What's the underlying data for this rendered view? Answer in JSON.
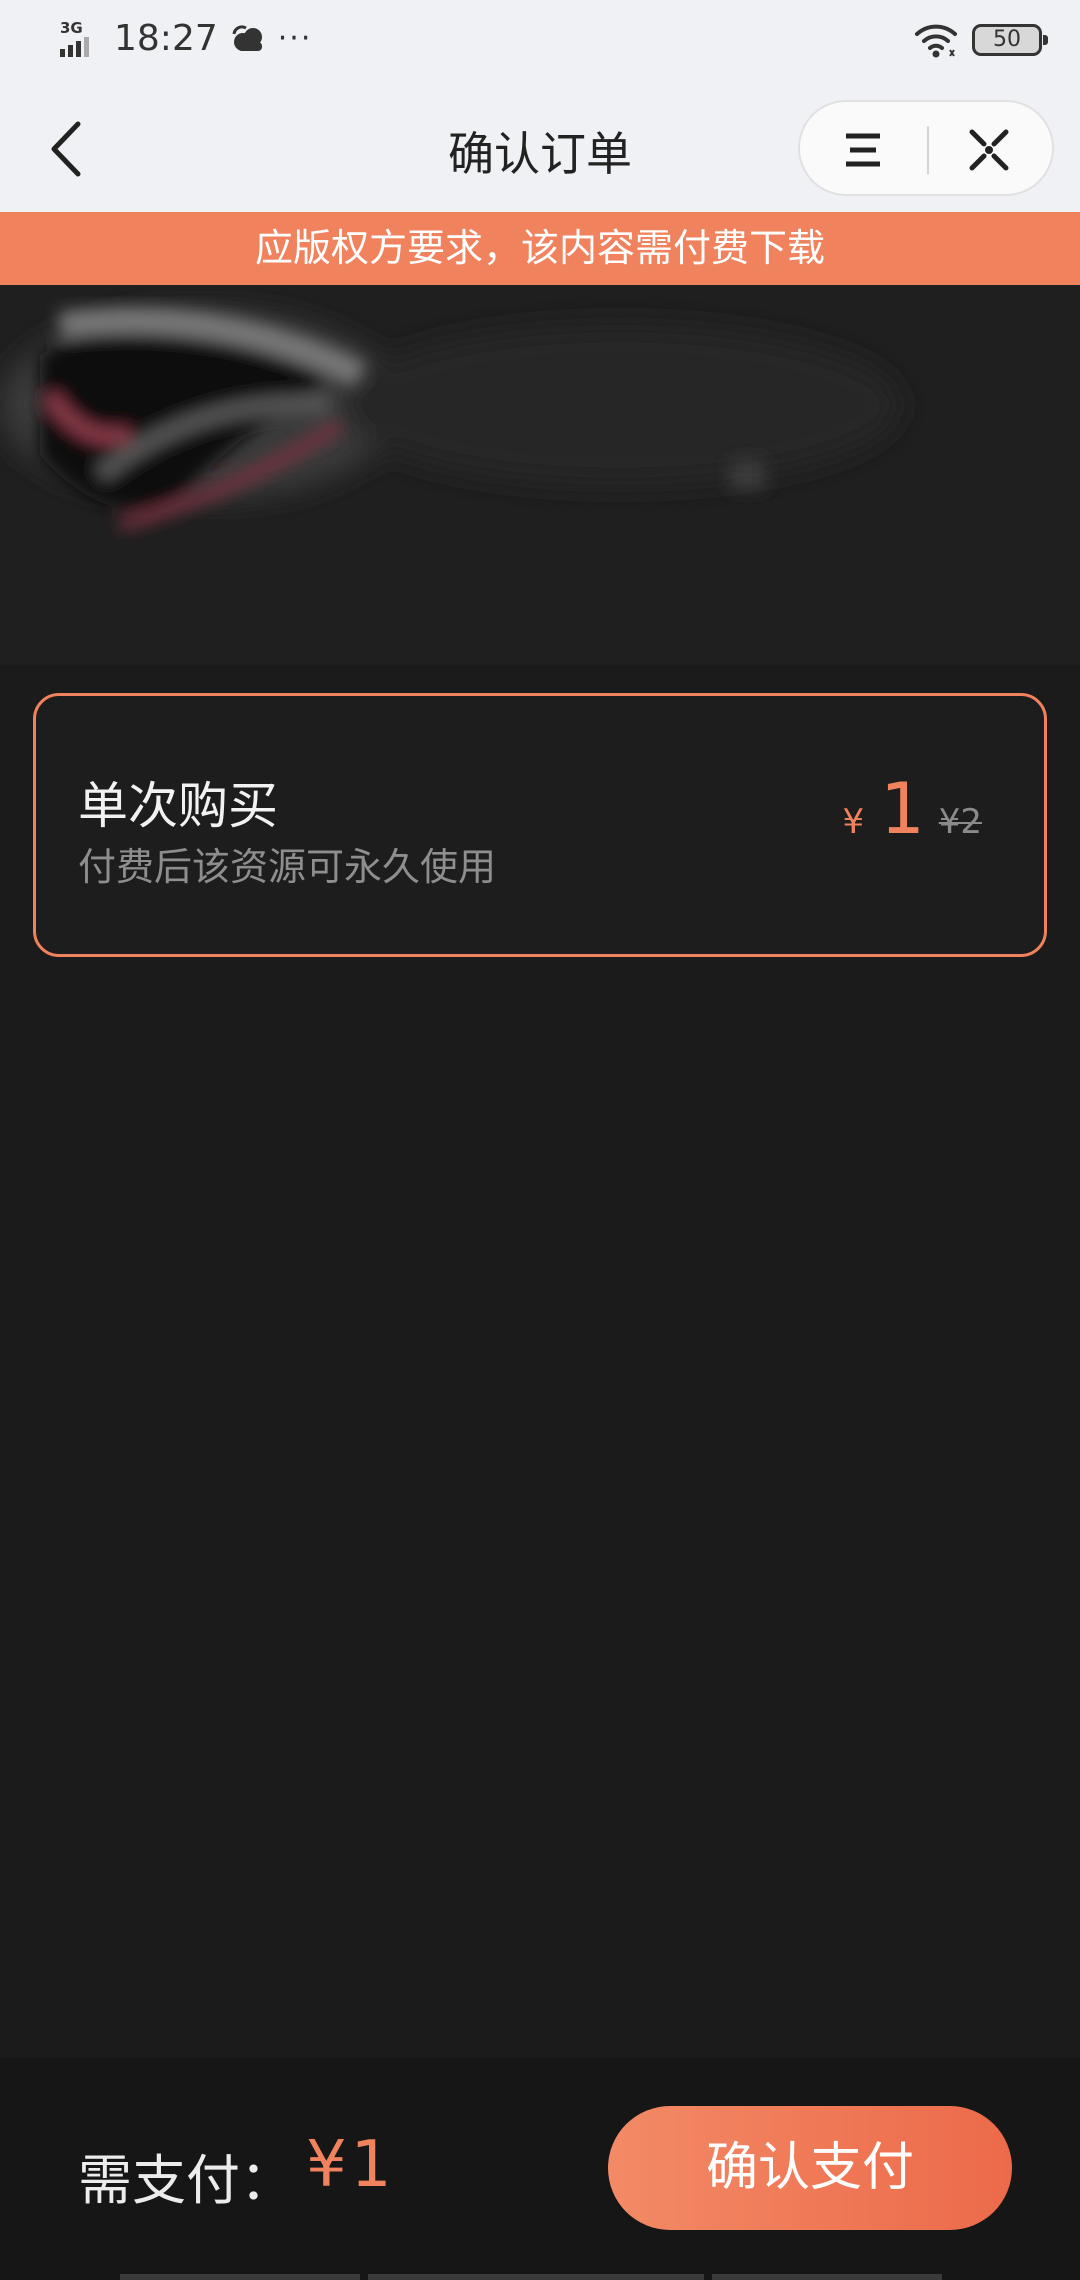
{
  "status_bar": {
    "network": "3G",
    "time": "18:27",
    "more_indicator": "···",
    "battery_level": "50",
    "icons": [
      "signal-icon",
      "weather-cloud-icon",
      "wifi-icon",
      "battery-icon"
    ]
  },
  "nav": {
    "title": "确认订单",
    "icons": [
      "back-arrow-icon",
      "menu-icon",
      "close-target-icon"
    ]
  },
  "notice": {
    "text": "应版权方要求，该内容需付费下载"
  },
  "option": {
    "title": "单次购买",
    "description": "付费后该资源可永久使用",
    "currency_symbol": "¥",
    "price": "1",
    "original_price": "¥2"
  },
  "footer": {
    "pay_label": "需支付：",
    "pay_amount": "¥1",
    "confirm_label": "确认支付"
  },
  "colors": {
    "accent": "#f0825e",
    "background": "#1b1b1b",
    "header_bg": "#f0f1f5"
  }
}
